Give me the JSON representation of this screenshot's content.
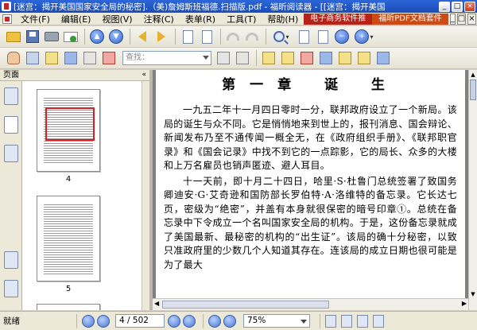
{
  "window": {
    "title": "[迷宫：揭开美国国家安全局的秘密].（美)詹姆斯班福德.扫描版.pdf - 福昕阅读器 - [[迷宫：揭开美国",
    "controls": {
      "minimize": "_",
      "maximize": "□",
      "close": "×"
    }
  },
  "menubar": {
    "items": [
      "文件(F)",
      "编辑(E)",
      "视图(V)",
      "注释(C)",
      "表单(R)",
      "工具(T)",
      "帮助(H)"
    ],
    "ads": [
      "电子商务软件推",
      "福昕PDF文档套件"
    ],
    "controls": {
      "minimize": "_",
      "restore": "□",
      "close": "×"
    }
  },
  "toolbar": {
    "find_placeholder": "查找："
  },
  "panel": {
    "title": "页面",
    "collapse": "«",
    "thumbnails": [
      {
        "label": "4"
      },
      {
        "label": "5"
      }
    ]
  },
  "document": {
    "chapter_title": "第一章  诞  生",
    "paragraphs": [
      "一九五二年十一月四日零时一分，联邦政府设立了一个新局。该局的诞生与众不同。它是悄悄地来到世上的，报刊消息、国会辩论、新闻发布乃至不通传闻一概全无，在《政府组织手册》、《联邦职官录》和《国会记录》中找不到它的一点踪影，它的局长、众多的大楼和上万名雇员也销声匿迹、避人耳目。",
      "十一天前，即十月二十四日，哈里·S·杜鲁门总统签署了致国务卿迪安·G·艾奇逊和国防部长罗伯特·A·洛维特的备忘录。它长达七页，密级为“绝密”，并盖有本身就很保密的暗号印章①。总统在备忘录中下令成立一个名叫国家安全局的机构。于是，这份备忘录就成了美国最新、最秘密的机构的“出生证”。该局的确十分秘密，以致只准政府里的少数几个人知道其存在。连该局的成立日期也很可能是为了最大"
    ]
  },
  "statusbar": {
    "status": "就绪",
    "page_indicator": "4 / 502",
    "zoom": "75%"
  }
}
